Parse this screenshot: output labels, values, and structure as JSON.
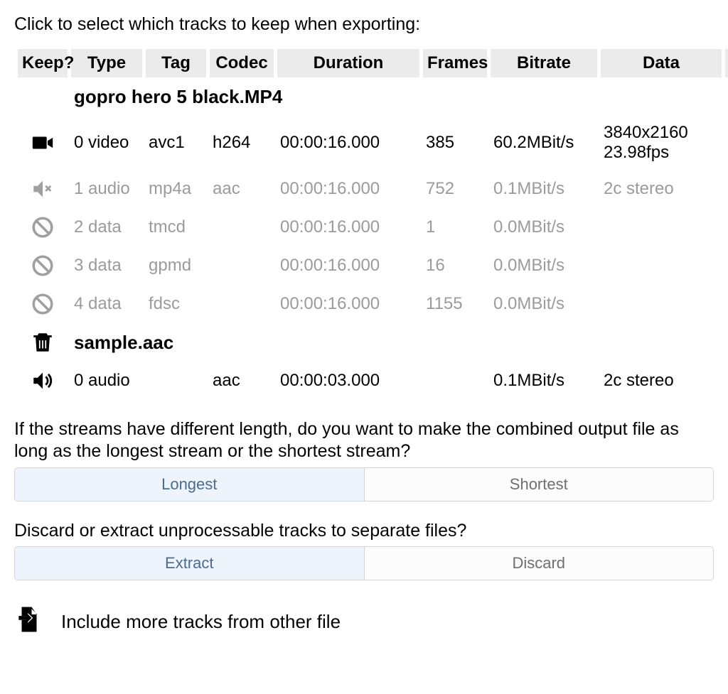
{
  "instruction": "Click to select which tracks to keep when exporting:",
  "headers": {
    "keep": "Keep?",
    "type": "Type",
    "tag": "Tag",
    "codec": "Codec",
    "duration": "Duration",
    "frames": "Frames",
    "bitrate": "Bitrate",
    "data": "Data"
  },
  "files": [
    {
      "name": "gopro hero 5 black.MP4",
      "tracks": [
        {
          "icon": "video",
          "active": true,
          "id": "0",
          "type": "video",
          "tag": "avc1",
          "codec": "h264",
          "duration": "00:00:16.000",
          "frames": "385",
          "bitrate": "60.2MBit/s",
          "data1": "3840x2160",
          "data2": "23.98fps"
        },
        {
          "icon": "audio-muted",
          "active": false,
          "id": "1",
          "type": "audio",
          "tag": "mp4a",
          "codec": "aac",
          "duration": "00:00:16.000",
          "frames": "752",
          "bitrate": "0.1MBit/s",
          "data1": "2c stereo",
          "data2": ""
        },
        {
          "icon": "ban",
          "active": false,
          "id": "2",
          "type": "data",
          "tag": "tmcd",
          "codec": "",
          "duration": "00:00:16.000",
          "frames": "1",
          "bitrate": "0.0MBit/s",
          "data1": "",
          "data2": ""
        },
        {
          "icon": "ban",
          "active": false,
          "id": "3",
          "type": "data",
          "tag": "gpmd",
          "codec": "",
          "duration": "00:00:16.000",
          "frames": "16",
          "bitrate": "0.0MBit/s",
          "data1": "",
          "data2": ""
        },
        {
          "icon": "ban",
          "active": false,
          "id": "4",
          "type": "data",
          "tag": "fdsc",
          "codec": "",
          "duration": "00:00:16.000",
          "frames": "1155",
          "bitrate": "0.0MBit/s",
          "data1": "",
          "data2": ""
        }
      ]
    },
    {
      "name": "sample.aac",
      "file_icon": "trash",
      "tracks": [
        {
          "icon": "audio-on",
          "active": true,
          "id": "0",
          "type": "audio",
          "tag": "",
          "codec": "aac",
          "duration": "00:00:03.000",
          "frames": "",
          "bitrate": "0.1MBit/s",
          "data1": "2c stereo",
          "data2": ""
        }
      ]
    }
  ],
  "length_question": "If the streams have different length, do you want to make the combined output file as long as the longest stream or the shortest stream?",
  "length_options": {
    "longest": "Longest",
    "shortest": "Shortest",
    "selected": "longest"
  },
  "discard_question": "Discard or extract unprocessable tracks to separate files?",
  "discard_options": {
    "extract": "Extract",
    "discard": "Discard",
    "selected": "extract"
  },
  "include_more": "Include more tracks from other file"
}
